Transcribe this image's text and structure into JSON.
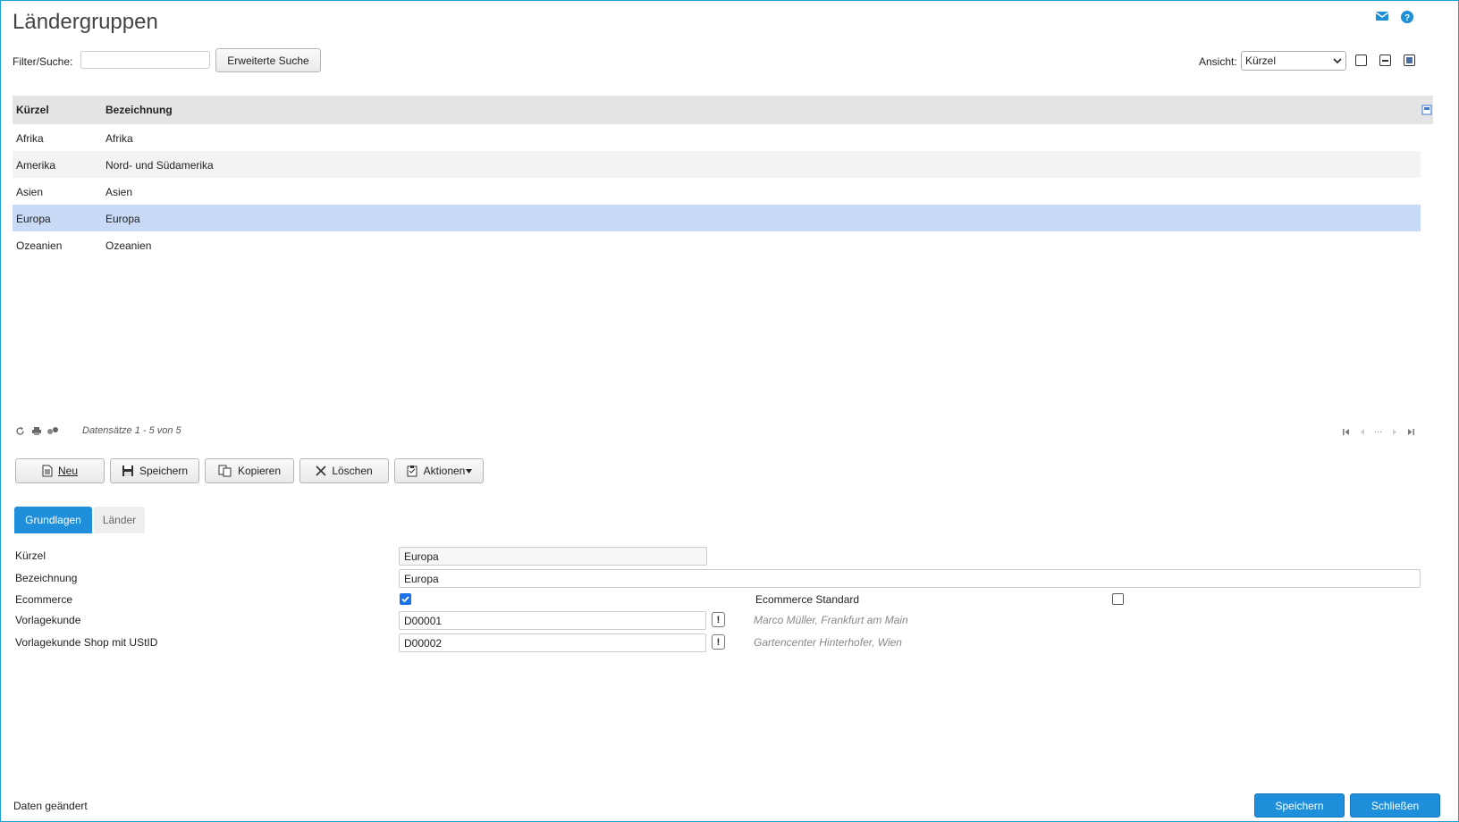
{
  "header": {
    "title": "Ländergruppen",
    "icons": [
      "mail-icon",
      "help-icon"
    ]
  },
  "filter": {
    "label": "Filter/Suche:",
    "value": "",
    "advanced_search_label": "Erweiterte Suche"
  },
  "view": {
    "label": "Ansicht:",
    "selected": "Kürzel"
  },
  "grid": {
    "columns": [
      "Kürzel",
      "Bezeichnung"
    ],
    "rows": [
      {
        "kuerzel": "Afrika",
        "bezeichnung": "Afrika"
      },
      {
        "kuerzel": "Amerika",
        "bezeichnung": "Nord- und Südamerika"
      },
      {
        "kuerzel": "Asien",
        "bezeichnung": "Asien"
      },
      {
        "kuerzel": "Europa",
        "bezeichnung": "Europa"
      },
      {
        "kuerzel": "Ozeanien",
        "bezeichnung": "Ozeanien"
      }
    ],
    "selected_row": "Europa",
    "records_text": "Datensätze 1 - 5 von 5",
    "pager_ellipsis": "..."
  },
  "toolbar": {
    "new": "Neu",
    "save": "Speichern",
    "copy": "Kopieren",
    "delete": "Löschen",
    "actions": "Aktionen"
  },
  "tabs": {
    "basics": "Grundlagen",
    "countries": "Länder"
  },
  "form": {
    "kuerzel_label": "Kürzel",
    "kuerzel_value": "Europa",
    "bezeichnung_label": "Bezeichnung",
    "bezeichnung_value": "Europa",
    "ecommerce_label": "Ecommerce",
    "ecommerce_checked": true,
    "ecommerce_standard_label": "Ecommerce Standard",
    "ecommerce_standard_checked": false,
    "vorlagekunde_label": "Vorlagekunde",
    "vorlagekunde_value": "D00001",
    "vorlagekunde_hint": "Marco Müller, Frankfurt am Main",
    "vorlagekunde_shop_label": "Vorlagekunde Shop mit UStID",
    "vorlagekunde_shop_value": "D00002",
    "vorlagekunde_shop_hint": "Gartencenter Hinterhofer, Wien",
    "lookup_symbol": "!"
  },
  "footer": {
    "status": "Daten geändert",
    "save": "Speichern",
    "close": "Schließen"
  },
  "colors": {
    "accent": "#1f8fdc",
    "selected_row": "#c8daf6",
    "header_bg": "#e4e4e4"
  }
}
